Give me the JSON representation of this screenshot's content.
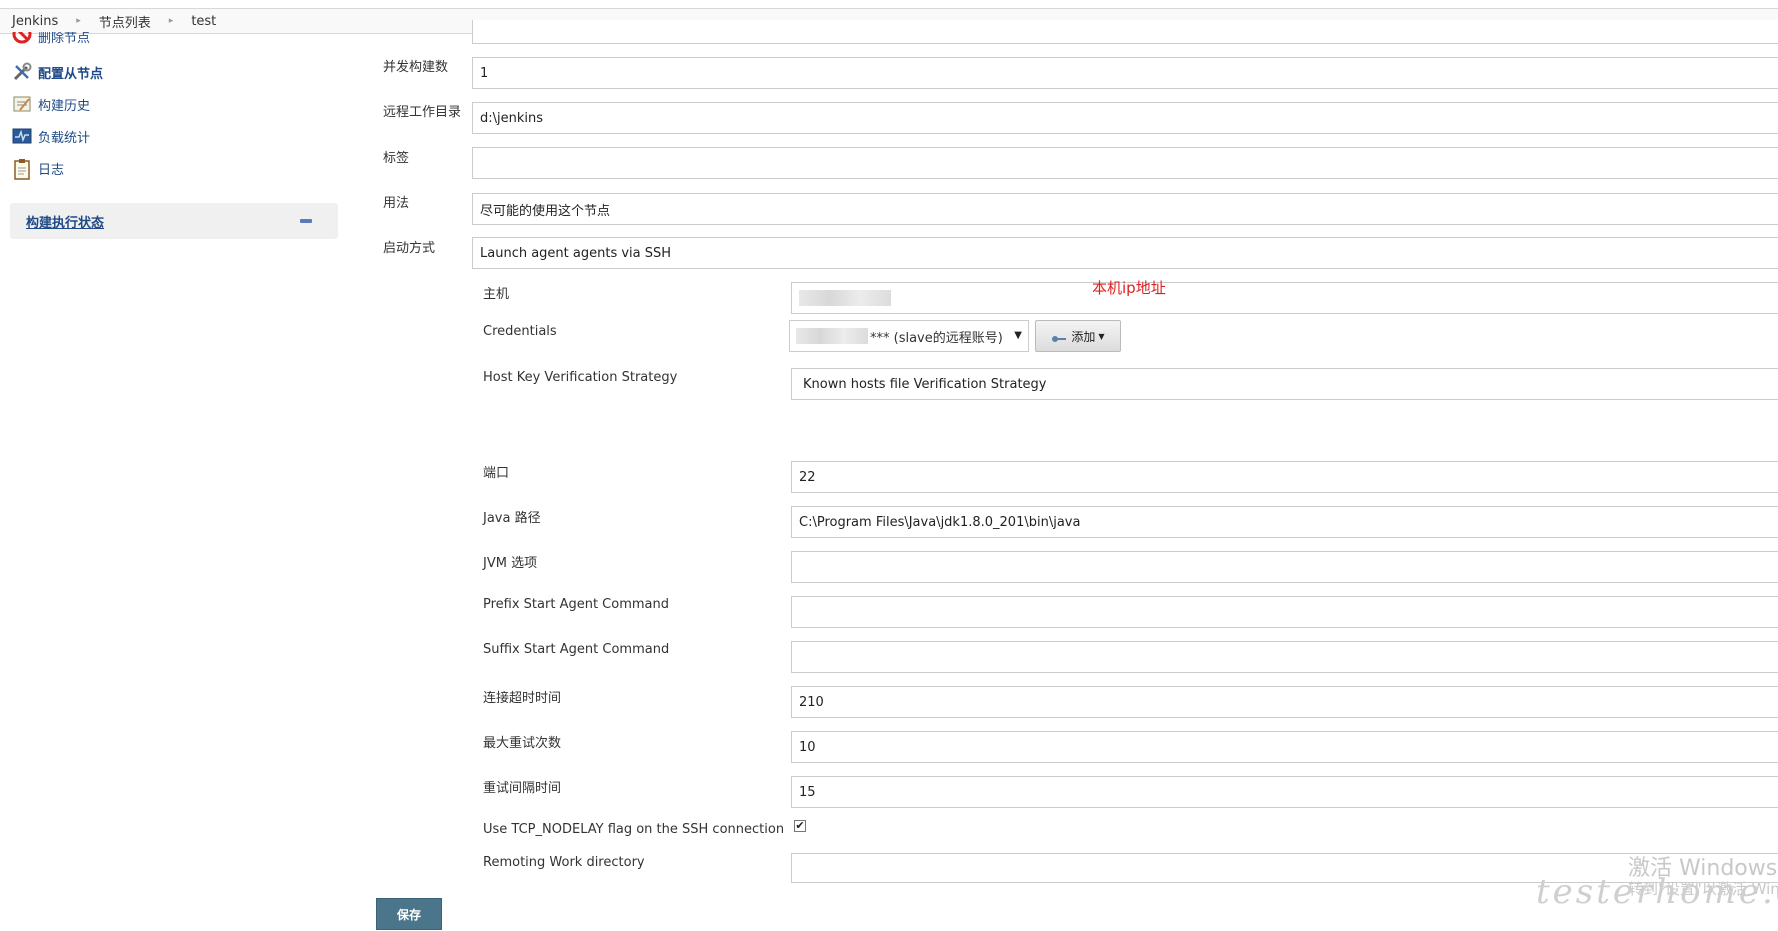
{
  "breadcrumb": [
    "Jenkins",
    "节点列表",
    "test"
  ],
  "sidebar": {
    "items": [
      {
        "label": "删除节点",
        "icon": "delete-icon"
      },
      {
        "label": "配置从节点",
        "icon": "configure-icon"
      },
      {
        "label": "构建历史",
        "icon": "build-history-icon"
      },
      {
        "label": "负载统计",
        "icon": "load-stats-icon"
      },
      {
        "label": "日志",
        "icon": "log-icon"
      }
    ],
    "executor_status": "构建执行状态"
  },
  "form": {
    "executors_label": "并发构建数",
    "executors_value": "1",
    "remote_dir_label": "远程工作目录",
    "remote_dir_value": "d:\\jenkins",
    "labels_label": "标签",
    "labels_value": "",
    "usage_label": "用法",
    "usage_value": "尽可能的使用这个节点",
    "launch_label": "启动方式",
    "launch_value": "Launch agent agents via SSH",
    "host_label": "主机",
    "host_annotation": "本机ip地址",
    "credentials_label": "Credentials",
    "credentials_value": "*** (slave的远程账号)",
    "add_button": "添加",
    "host_key_label": "Host Key Verification Strategy",
    "host_key_value": "Known hosts file Verification Strategy",
    "port_label": "端口",
    "port_value": "22",
    "java_label": "Java 路径",
    "java_value": "C:\\Program Files\\Java\\jdk1.8.0_201\\bin\\java",
    "jvm_label": "JVM 选项",
    "jvm_value": "",
    "prefix_label": "Prefix Start Agent Command",
    "suffix_label": "Suffix Start Agent Command",
    "timeout_label": "连接超时时间",
    "timeout_value": "210",
    "retries_label": "最大重试次数",
    "retries_value": "10",
    "retry_wait_label": "重试间隔时间",
    "retry_wait_value": "15",
    "tcp_label": "Use TCP_NODELAY flag on the SSH connection",
    "tcp_checked": "✔",
    "remoting_label": "Remoting Work directory"
  },
  "save_button": "保存",
  "watermark": {
    "line1": "激活 Windows",
    "line2": "转到\"设置\"以激活 Windows。",
    "site": "testerhome.com"
  },
  "colors": {
    "save_button": "#4b758b",
    "link": "#204a87",
    "annotation": "#e02020"
  }
}
